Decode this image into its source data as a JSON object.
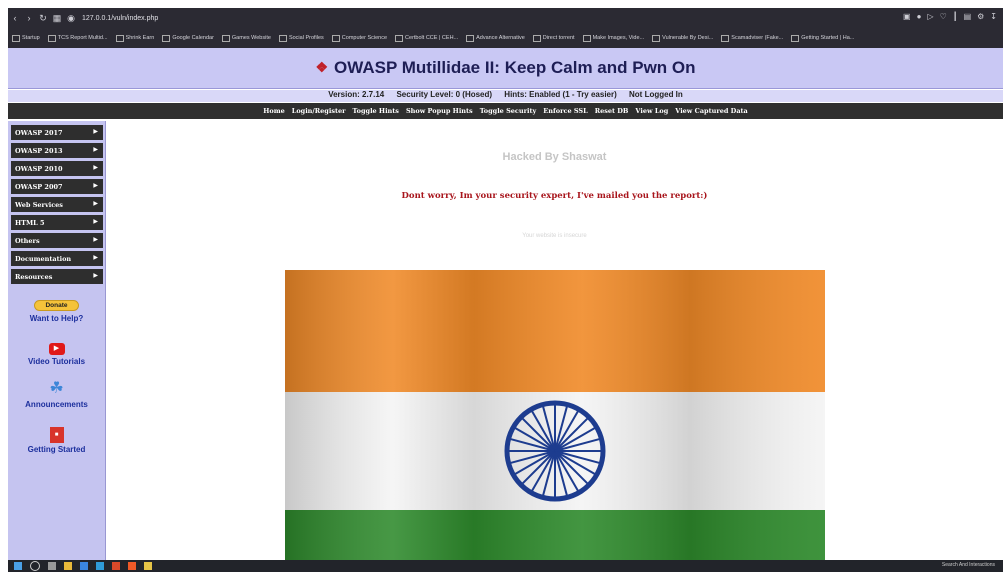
{
  "browser": {
    "url": "127.0.0.1/vuln/index.php",
    "bookmarks": [
      "Startup",
      "TCS Report Multid...",
      "Shrink Earn",
      "Google Calendar",
      "Games Website",
      "Social Profiles",
      "Computer Science",
      "Certbolt CCE | CEH...",
      "Advance Alternative",
      "Direct torrent",
      "Make Images, Vide...",
      "Vulnerable By Desi...",
      "Scamadviser (Fake...",
      "Getting Started | Ha..."
    ]
  },
  "header": {
    "title": "OWASP Mutillidae II: Keep Calm and Pwn On",
    "version": "Version: 2.7.14",
    "security_level": "Security Level: 0 (Hosed)",
    "hints": "Hints: Enabled (1 - Try easier)",
    "login_status": "Not Logged In"
  },
  "menu": [
    "Home",
    "Login/Register",
    "Toggle Hints",
    "Show Popup Hints",
    "Toggle Security",
    "Enforce SSL",
    "Reset DB",
    "View Log",
    "View Captured Data"
  ],
  "sidebar": {
    "items": [
      "OWASP 2017",
      "OWASP 2013",
      "OWASP 2010",
      "OWASP 2007",
      "Web Services",
      "HTML 5",
      "Others",
      "Documentation",
      "Resources"
    ],
    "donate": "Donate",
    "want_help": "Want to Help?",
    "video": "Video Tutorials",
    "announcements": "Announcements",
    "getting_started": "Getting Started"
  },
  "main": {
    "hacked": "Hacked By Shaswat",
    "message": "Dont worry, Im your security expert, I've mailed you the report:)",
    "insecure": "Your website is insecure"
  },
  "taskbar": {
    "tray": "Search And Interactions"
  },
  "colors": {
    "saffron": "#f08a28",
    "white": "#f4f4f4",
    "green": "#2e8a2c",
    "chakra": "#1d3c8f"
  }
}
